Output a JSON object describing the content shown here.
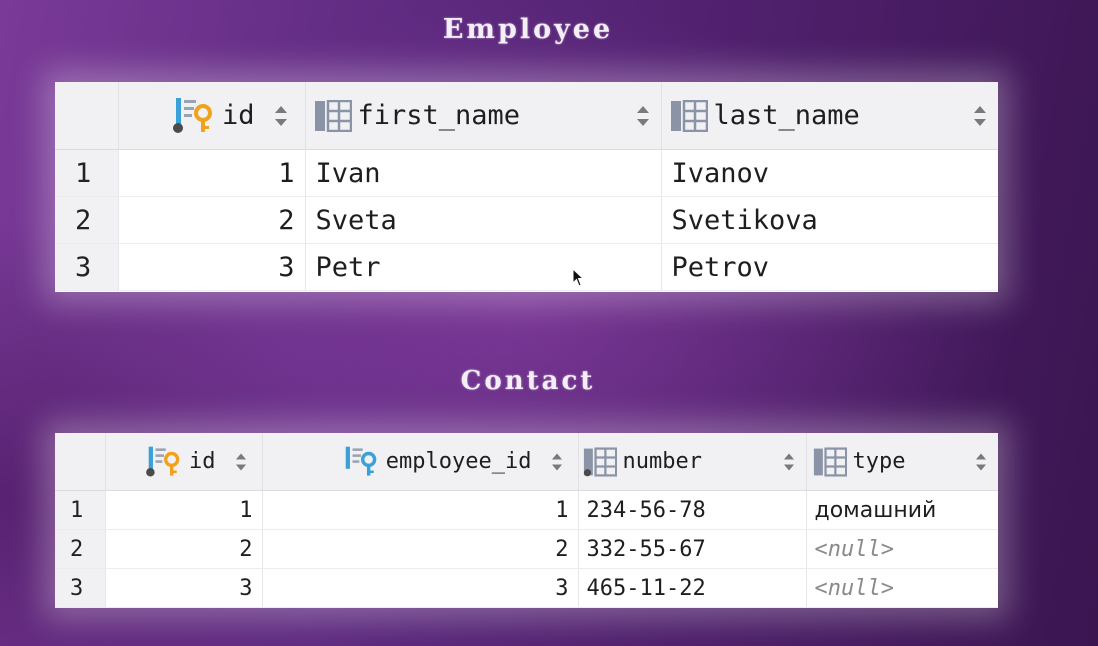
{
  "employee": {
    "title": "Employee",
    "columns": {
      "id": "id",
      "first_name": "first_name",
      "last_name": "last_name"
    },
    "rows": [
      {
        "num": "1",
        "id": "1",
        "first_name": "Ivan",
        "last_name": "Ivanov"
      },
      {
        "num": "2",
        "id": "2",
        "first_name": "Sveta",
        "last_name": "Svetikova"
      },
      {
        "num": "3",
        "id": "3",
        "first_name": "Petr",
        "last_name": "Petrov"
      }
    ]
  },
  "contact": {
    "title": "Contact",
    "columns": {
      "id": "id",
      "employee_id": "employee_id",
      "number": "number",
      "type": "type"
    },
    "rows": [
      {
        "num": "1",
        "id": "1",
        "employee_id": "1",
        "number": "234-56-78",
        "type": "домашний"
      },
      {
        "num": "2",
        "id": "2",
        "employee_id": "2",
        "number": "332-55-67",
        "type": "<null>"
      },
      {
        "num": "3",
        "id": "3",
        "employee_id": "3",
        "number": "465-11-22",
        "type": "<null>"
      }
    ]
  },
  "icons": {
    "primary_key_column": "primary-key-column-icon",
    "foreign_key_column": "foreign-key-column-icon",
    "column": "column-icon",
    "sort": "sort-icon"
  },
  "colors": {
    "key": "#f0a21e",
    "fk": "#3aa0d8",
    "pk_bar": "#3aa0d8",
    "column_icon": "#8a94a6"
  }
}
